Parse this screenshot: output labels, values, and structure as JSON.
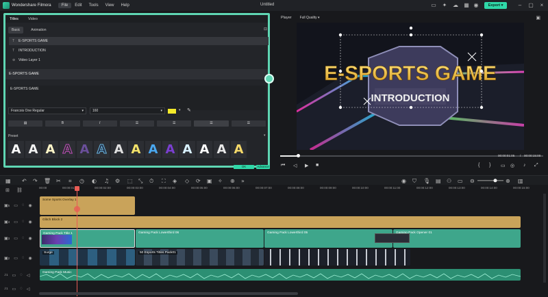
{
  "menubar": {
    "app_name": "Wondershare Filmora",
    "items": [
      "File",
      "Edit",
      "Tools",
      "View",
      "Help"
    ],
    "doc_title": "Untitled",
    "export_label": "Export"
  },
  "panel": {
    "tabs": [
      "Titles",
      "Video"
    ],
    "subtabs": [
      "Basic",
      "Animation"
    ],
    "layers": [
      "E-SPORTS GAME",
      "INTRODUCTION",
      "Video Layer 1"
    ],
    "section_title": "E-SPORTS GAME",
    "text_value": "E-SPORTS GAME",
    "font_name": "Francois One Regular",
    "font_size": "160",
    "text_color": "#f4ea2a",
    "format_buttons": [
      "B",
      "I"
    ],
    "preset_label": "Preset",
    "preset_glyph": "A",
    "ok_label": "OK",
    "advanced_label": "Advance"
  },
  "player": {
    "label": "Player",
    "quality": "Full Quality",
    "title_line1": "E-SPORTS GAME",
    "title_line2": "INTRODUCTION",
    "current_time": "00:00:01:05",
    "total_time": "00:00:15:00"
  },
  "timeline": {
    "ruler": [
      "00:00",
      "00:00:01:00",
      "00:00:02:00",
      "00:00:03:00",
      "00:00:04:00",
      "00:00:05:00",
      "00:00:06:00",
      "00:00:07:00",
      "00:00:08:00",
      "00:00:09:00",
      "00:00:10:00",
      "00:00:11:00",
      "00:00:12:00",
      "00:00:13:00",
      "00:00:14:00",
      "00:00:15:00"
    ],
    "track_nums": [
      "5",
      "4",
      "3",
      "2",
      "1",
      "1"
    ],
    "clips": {
      "t5": "Some Sports Overlay 1",
      "t4": "Glitch Block 2",
      "t3a": "Gaming Pack Title 1",
      "t3b": "Gaming Pack Lowerthird 06",
      "t3c": "Gaming Pack Lowerthird 05",
      "t3d": "Gaming Pack Opener 01",
      "t2a": "Surge",
      "t2b": "50 Esports Titles Pack01",
      "t1": "Gaming Pack Music"
    }
  }
}
